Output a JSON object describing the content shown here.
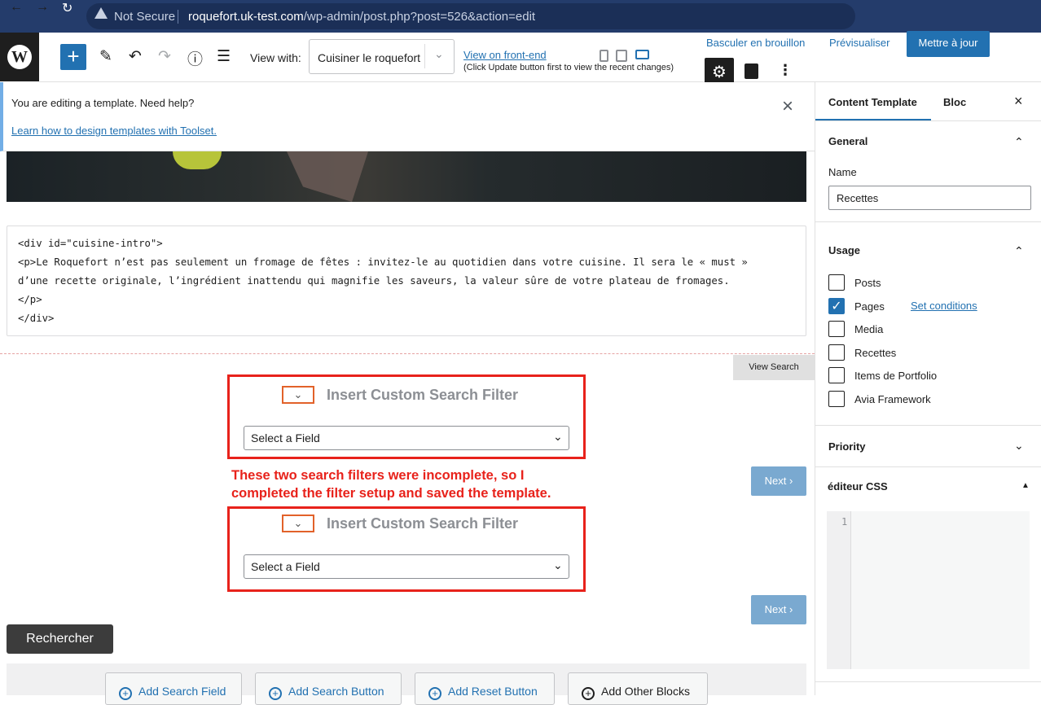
{
  "browser": {
    "security_label": "Not Secure",
    "url_host": "roquefort.uk-test.com",
    "url_path": "/wp-admin/post.php?post=526&action=edit",
    "back_icon": "←",
    "forward_icon": "→",
    "reload_icon": "↻"
  },
  "toolbar": {
    "wp_logo": "W",
    "add_label": "+",
    "edit_icon": "✎",
    "undo_icon": "↶",
    "redo_icon": "↷",
    "info_icon": "ⓘ",
    "list_icon": "☰",
    "view_with_label": "View with:",
    "view_with_value": "Cuisiner le roquefort",
    "view_chevron": "⌄",
    "front_end_link": "View on front-end",
    "front_end_note": "(Click Update button first to view the recent changes)",
    "draft_button": "Basculer en brouillon",
    "preview_button": "Prévisualiser",
    "update_button": "Mettre à jour",
    "settings_icon": "⚙",
    "more_icon": "⋮"
  },
  "notice": {
    "text": "You are editing a template. Need help?",
    "link": "Learn how to design templates with Toolset.",
    "close": "×"
  },
  "code": {
    "lines": [
      "<div id=\"cuisine-intro\">",
      "<p>Le Roquefort n’est pas seulement un fromage de fêtes : invitez-le au quotidien dans votre cuisine. Il sera le « must »",
      "d’une recette originale, l’ingrédient inattendu qui magnifie les saveurs, la valeur sûre de votre plateau de fromages.",
      "</p>",
      "</div>"
    ]
  },
  "search": {
    "view_search_button": "View Search",
    "filters": [
      {
        "title": "Insert Custom Search Filter",
        "select_value": "Select a Field",
        "chevron": "⌄",
        "toggle": "⌄"
      },
      {
        "title": "Insert Custom Search Filter",
        "select_value": "Select a Field",
        "chevron": "⌄",
        "toggle": "⌄"
      }
    ],
    "next_label": "Next ›",
    "annotation_line1": "These two search filters were incomplete, so I",
    "annotation_line2": "completed the filter setup and saved the template.",
    "submit_button": "Rechercher",
    "add_buttons": [
      "Add Search Field",
      "Add Search Button",
      "Add Reset Button",
      "Add Other Blocks"
    ],
    "plus": "+"
  },
  "sidebar": {
    "tab_content_template": "Content Template",
    "tab_block": "Bloc",
    "close": "×",
    "general_title": "General",
    "name_label": "Name",
    "name_value": "Recettes",
    "usage_title": "Usage",
    "usage_items": [
      {
        "label": "Posts",
        "checked": false
      },
      {
        "label": "Pages",
        "checked": true
      },
      {
        "label": "Media",
        "checked": false
      },
      {
        "label": "Recettes",
        "checked": false
      },
      {
        "label": "Items de Portfolio",
        "checked": false
      },
      {
        "label": "Avia Framework",
        "checked": false
      }
    ],
    "check_mark": "✓",
    "set_conditions": "Set conditions",
    "priority_title": "Priority",
    "css_title": "éditeur CSS",
    "chev_up": "⌃",
    "chev_down": "⌄",
    "tri_up": "▲",
    "line_number": "1"
  }
}
